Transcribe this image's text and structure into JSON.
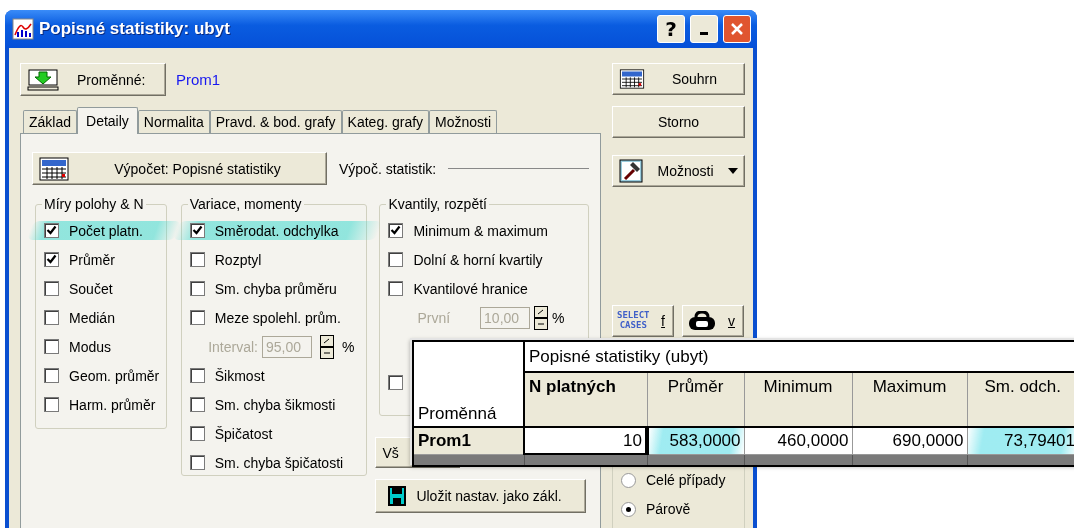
{
  "window": {
    "title": "Popisné statistiky: ubyt",
    "help_label": "?"
  },
  "variables": {
    "label": "Proměnné:",
    "value": "Prom1"
  },
  "tabs": [
    {
      "label": "Základ",
      "selected": false
    },
    {
      "label": "Detaily",
      "selected": true
    },
    {
      "label": "Normalita",
      "selected": false
    },
    {
      "label": "Pravd. & bod. grafy",
      "selected": false
    },
    {
      "label": "Kateg. grafy",
      "selected": false
    },
    {
      "label": "Možnosti",
      "selected": false
    }
  ],
  "compute": {
    "button": "Výpočet: Popisné statistiky",
    "label": "Výpoč. statistik:"
  },
  "groups": [
    {
      "title": "Míry polohy & N",
      "items": [
        {
          "kind": "checkbox",
          "label": "Počet platn.",
          "checked": true,
          "highlighted": true
        },
        {
          "kind": "checkbox",
          "label": "Průměr",
          "checked": true,
          "highlighted": false
        },
        {
          "kind": "checkbox",
          "label": "Součet",
          "checked": false,
          "highlighted": false
        },
        {
          "kind": "checkbox",
          "label": "Medián",
          "checked": false,
          "highlighted": false
        },
        {
          "kind": "checkbox",
          "label": "Modus",
          "checked": false,
          "highlighted": false
        },
        {
          "kind": "checkbox",
          "label": "Geom. průměr",
          "checked": false,
          "highlighted": false
        },
        {
          "kind": "checkbox",
          "label": "Harm. průměr",
          "checked": false,
          "highlighted": false
        }
      ]
    },
    {
      "title": "Variace, momenty",
      "items": [
        {
          "kind": "checkbox",
          "label": "Směrodat. odchylka",
          "checked": true,
          "highlighted": true
        },
        {
          "kind": "checkbox",
          "label": "Rozptyl",
          "checked": false,
          "highlighted": false
        },
        {
          "kind": "checkbox",
          "label": "Sm. chyba průměru",
          "checked": false,
          "highlighted": false
        },
        {
          "kind": "checkbox",
          "label": "Meze spolehl. prům.",
          "checked": false,
          "highlighted": false
        },
        {
          "kind": "spinner",
          "label": "Interval:",
          "value": "95,00",
          "unit": "%",
          "disabled": true
        },
        {
          "kind": "checkbox",
          "label": "Šikmost",
          "checked": false,
          "highlighted": false
        },
        {
          "kind": "checkbox",
          "label": "Sm. chyba šikmosti",
          "checked": false,
          "highlighted": false
        },
        {
          "kind": "checkbox",
          "label": "Špičatost",
          "checked": false,
          "highlighted": false
        },
        {
          "kind": "checkbox",
          "label": "Sm. chyba špičatosti",
          "checked": false,
          "highlighted": false
        }
      ]
    },
    {
      "title": "Kvantily, rozpětí",
      "items": [
        {
          "kind": "checkbox",
          "label": "Minimum & maximum",
          "checked": true,
          "highlighted": false
        },
        {
          "kind": "checkbox",
          "label": "Dolní & horní kvartily",
          "checked": false,
          "highlighted": false
        },
        {
          "kind": "checkbox",
          "label": "Kvantilové hranice",
          "checked": false,
          "highlighted": false
        },
        {
          "kind": "spinner",
          "label": "První",
          "value": "10,00",
          "unit": "%",
          "disabled": true
        },
        {
          "kind": "checkbox",
          "checked": false
        }
      ]
    }
  ],
  "partial_button": "Vš",
  "save_button": "Uložit nastav. jako zákl.",
  "side_buttons": [
    {
      "kind": "summary",
      "label": "Souhrn"
    },
    {
      "kind": "plain",
      "label": "Storno"
    },
    {
      "kind": "options",
      "label": "Možnosti"
    }
  ],
  "tool_buttons": [
    {
      "kind": "select-cases",
      "badge_lines": [
        "SELECT",
        "CASES"
      ],
      "label": "f"
    },
    {
      "kind": "weight",
      "label": "v"
    }
  ],
  "pairing": [
    {
      "label": "Celé případy",
      "selected": false
    },
    {
      "label": "Párově",
      "selected": true
    }
  ],
  "results_table": {
    "title": "Popisné statistiky (ubyt)",
    "row_header": "Proměnná",
    "columns": [
      {
        "label": "N platných",
        "bold": true
      },
      {
        "label": "Průměr",
        "bold": false
      },
      {
        "label": "Minimum",
        "bold": false
      },
      {
        "label": "Maximum",
        "bold": false
      },
      {
        "label": "Sm. odch.",
        "bold": false
      }
    ],
    "rows": [
      {
        "label": "Prom1",
        "cells": [
          {
            "value": "10",
            "selected": true,
            "highlighted": false
          },
          {
            "value": "583,0000",
            "selected": false,
            "highlighted": true
          },
          {
            "value": "460,0000",
            "selected": false,
            "highlighted": false
          },
          {
            "value": "690,0000",
            "selected": false,
            "highlighted": false
          },
          {
            "value": "73,79401",
            "selected": false,
            "highlighted": true
          }
        ]
      }
    ]
  }
}
